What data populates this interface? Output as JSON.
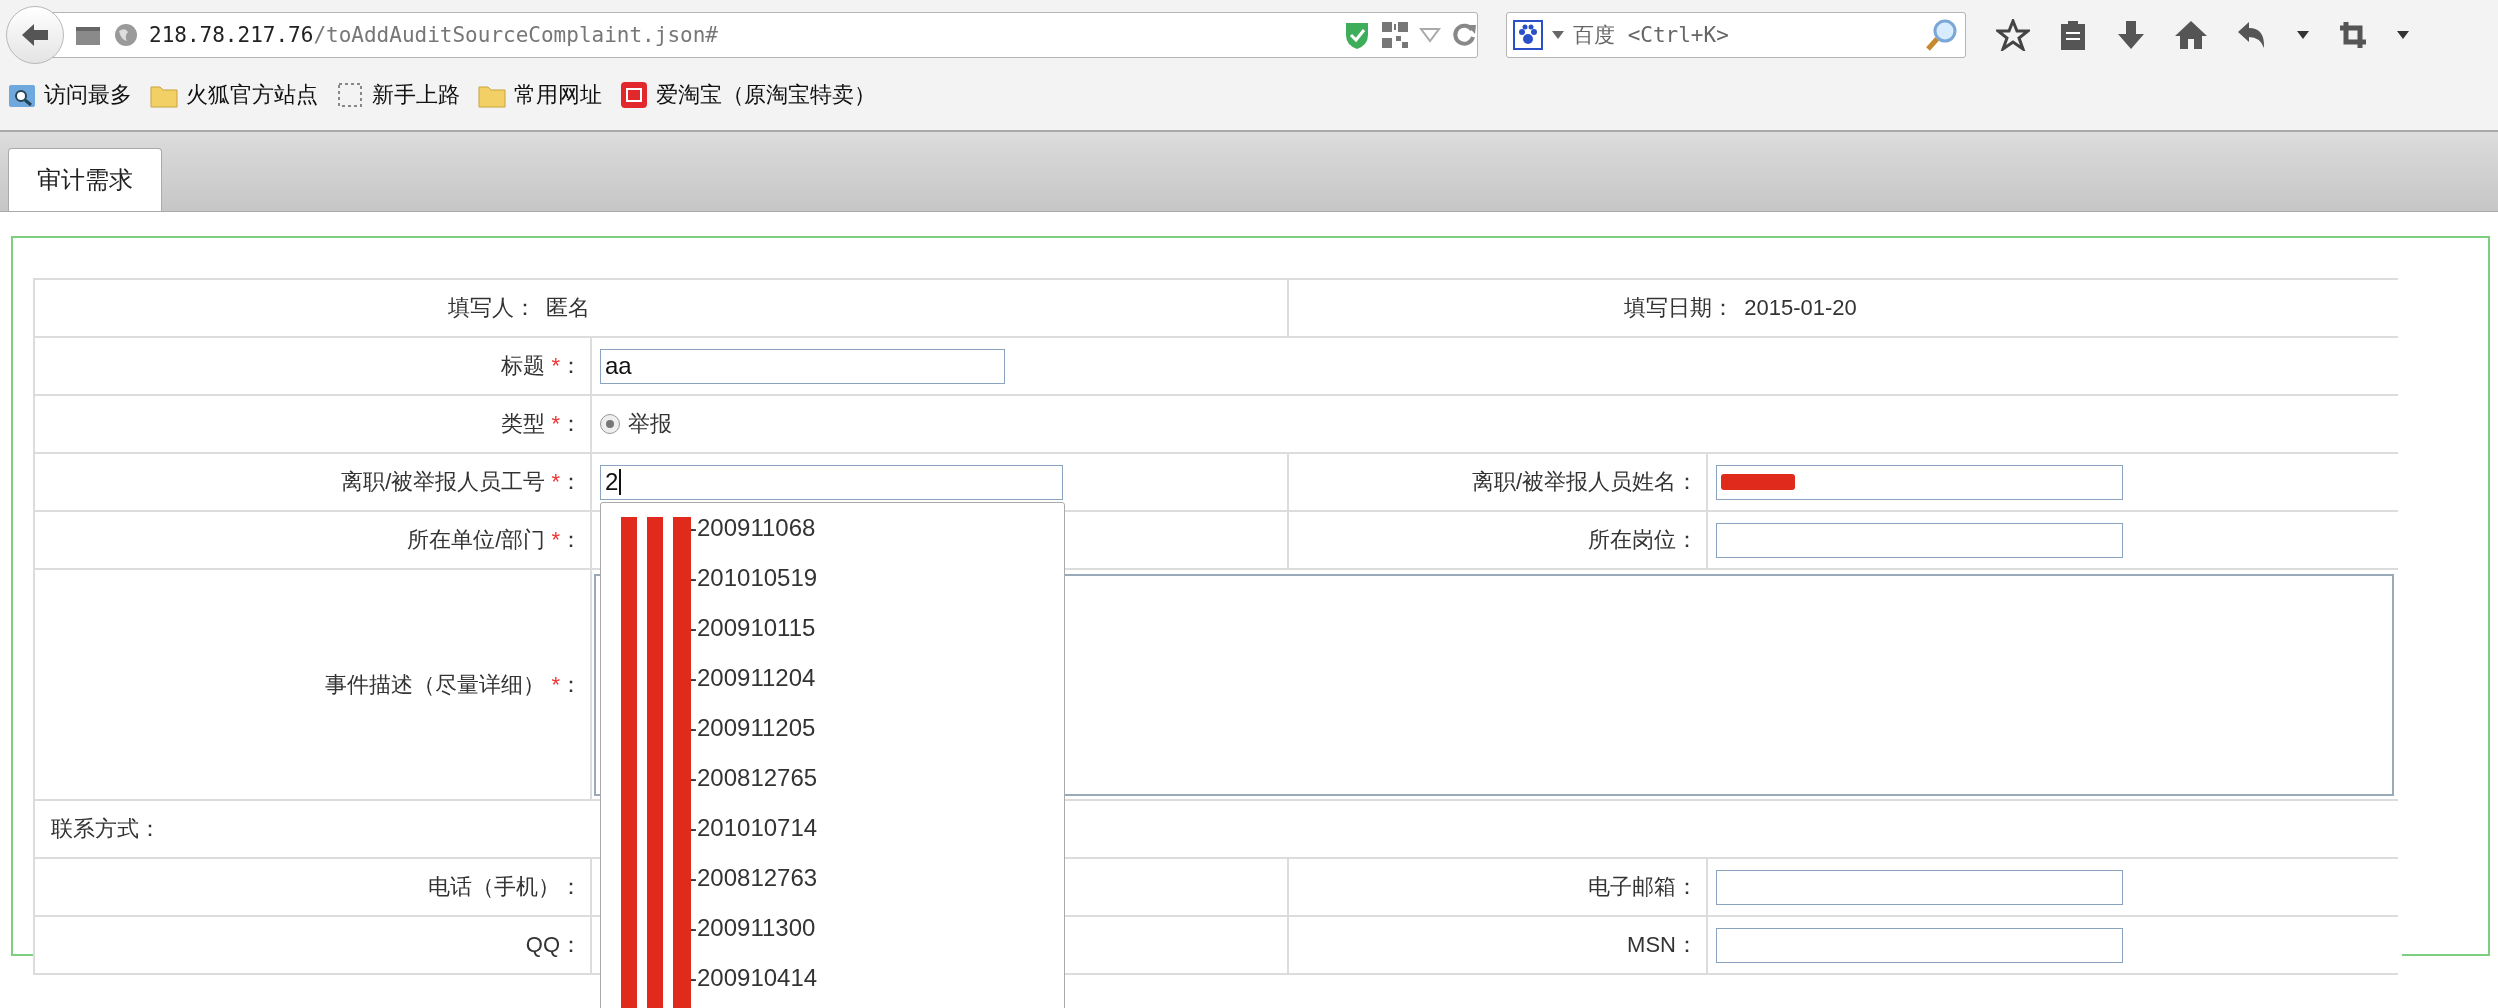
{
  "browser": {
    "url_host": "218.78.217.76",
    "url_path": "/toAddAuditSourceComplaint.json#",
    "search_placeholder": "百度 <Ctrl+K>",
    "bookmarks": [
      {
        "label": "访问最多",
        "kind": "smart"
      },
      {
        "label": "火狐官方站点",
        "kind": "folder"
      },
      {
        "label": "新手上路",
        "kind": "page"
      },
      {
        "label": "常用网址",
        "kind": "folder"
      },
      {
        "label": "爱淘宝（原淘宝特卖）",
        "kind": "site"
      }
    ]
  },
  "tabs": [
    {
      "label": "审计需求",
      "selected": true
    }
  ],
  "form": {
    "rows": [
      {
        "kind": "info",
        "cells": [
          {
            "label": "填写人：",
            "value": "匿名"
          },
          {
            "label": "填写日期：",
            "value": "2015-01-20"
          }
        ]
      },
      {
        "kind": "single",
        "label": "标题",
        "mark": "*",
        "suffix": "：",
        "control": {
          "kind": "text",
          "value": "aa"
        }
      },
      {
        "kind": "single",
        "label": "类型",
        "mark": "*",
        "suffix": "：",
        "control": {
          "kind": "radio",
          "label": "举报",
          "selected": true
        }
      },
      {
        "kind": "pair",
        "left": {
          "label": "离职/被举报人员工号",
          "mark": "*",
          "suffix": "：",
          "control": {
            "kind": "text",
            "value": "2",
            "focused": true,
            "suggestions": [
              "-200911068",
              "-201010519",
              "-200910115",
              "-200911204",
              "-200911205",
              "-200812765",
              "-201010714",
              "-200812763",
              "-200911300",
              "-200910414"
            ]
          }
        },
        "right": {
          "label": "离职/被举报人员姓名：",
          "control": {
            "kind": "text",
            "redacted": true
          }
        }
      },
      {
        "kind": "pair",
        "left": {
          "label": "所在单位/部门",
          "mark": "*",
          "suffix": "："
        },
        "right": {
          "label": "所在岗位：",
          "control": {
            "kind": "text"
          }
        }
      },
      {
        "kind": "single",
        "label": "事件描述（尽量详细）",
        "mark": "*",
        "suffix": "：",
        "control": {
          "kind": "textarea"
        }
      },
      {
        "kind": "section",
        "label": "联系方式："
      },
      {
        "kind": "pair",
        "left": {
          "label": "电话（手机）："
        },
        "right": {
          "label": "电子邮箱：",
          "control": {
            "kind": "text"
          }
        }
      },
      {
        "kind": "pair",
        "left": {
          "label": "QQ："
        },
        "right": {
          "label": "MSN：",
          "control": {
            "kind": "text"
          }
        }
      }
    ]
  }
}
